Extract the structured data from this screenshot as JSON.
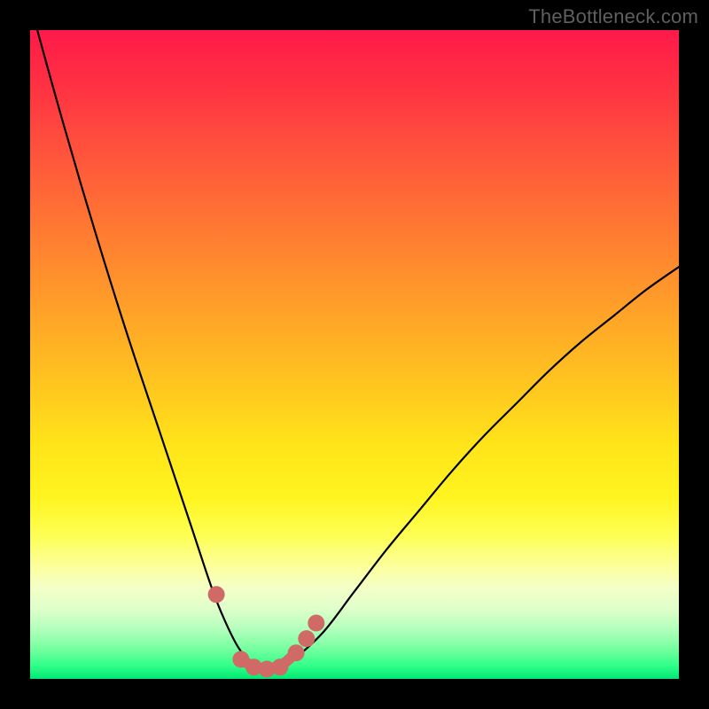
{
  "watermark": "TheBottleneck.com",
  "colors": {
    "frame": "#000000",
    "curve": "#000000",
    "markers": "#cf6a67",
    "gradient_top": "#ff1a49",
    "gradient_bottom": "#00e874"
  },
  "chart_data": {
    "type": "line",
    "title": "",
    "xlabel": "",
    "ylabel": "",
    "xlim": [
      0,
      100
    ],
    "ylim": [
      0,
      100
    ],
    "series": [
      {
        "name": "bottleneck-curve",
        "x": [
          0,
          5,
          10,
          15,
          20,
          25,
          28,
          30,
          32,
          34,
          36,
          38,
          40,
          45,
          50,
          55,
          60,
          65,
          70,
          75,
          80,
          85,
          90,
          95,
          100
        ],
        "y": [
          104,
          86,
          69,
          53,
          38,
          23,
          14,
          9,
          5,
          2.5,
          1.5,
          1.5,
          2.5,
          7,
          13.5,
          20,
          26,
          32,
          37.5,
          42.5,
          47.5,
          52,
          56,
          60,
          63.5
        ]
      }
    ],
    "markers": {
      "name": "highlighted-points",
      "x": [
        28.7,
        32.5,
        34.5,
        36.5,
        38.5,
        41.0,
        42.6,
        44.1
      ],
      "y": [
        13.0,
        3.0,
        1.8,
        1.5,
        1.8,
        4.0,
        6.2,
        8.6
      ]
    },
    "marker_connector": {
      "x": [
        32.5,
        34.5,
        36.5,
        38.5,
        41.0
      ],
      "y": [
        3.0,
        1.8,
        1.5,
        1.8,
        4.0
      ]
    }
  }
}
